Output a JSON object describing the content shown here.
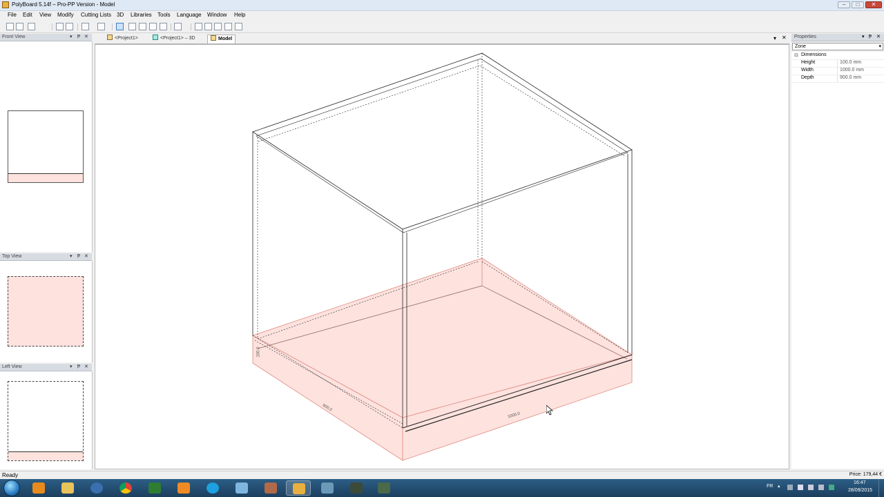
{
  "window": {
    "title": "PolyBoard 5.14f – Pro-PP Version - Model",
    "controls": {
      "minimize": "–",
      "maximize": "□",
      "close": "✕"
    }
  },
  "menu": [
    "File",
    "Edit",
    "View",
    "Modify",
    "Cutting Lists",
    "3D",
    "Libraries",
    "Tools",
    "Language",
    "Window",
    "Help"
  ],
  "toolbar": {
    "buttons": [
      "new-icon",
      "open-icon",
      "save-icon",
      "print-icon",
      "print-preview-icon",
      "undo-icon",
      "redo-icon",
      "select-icon",
      "cube-icon",
      "zoom-in-icon",
      "zoom-out-icon",
      "zoom-extents-icon",
      "pan-icon"
    ]
  },
  "left_panels": {
    "front": {
      "title": "Front View"
    },
    "top": {
      "title": "Top View"
    },
    "left": {
      "title": "Left View"
    },
    "panel_buttons": {
      "dropdown": "▾",
      "pin": "ᵽ",
      "close": "✕"
    }
  },
  "document": {
    "tabs": [
      {
        "label": "<Project1>",
        "icon": "project-icon",
        "active": false
      },
      {
        "label": "<Project1> – 3D",
        "icon": "cube-icon",
        "active": false
      },
      {
        "label": "Model",
        "icon": "model-icon",
        "active": true
      }
    ],
    "controls": {
      "dropdown": "▾",
      "close": "✕"
    }
  },
  "model": {
    "dim_height": "100.0",
    "dim_depth": "900.0",
    "dim_width": "1000.0",
    "colors": {
      "zone_fill": "#fde2de",
      "zone_edge": "#e08a80",
      "line": "#222222"
    }
  },
  "properties": {
    "title": "Properties",
    "selector": "Zone",
    "group": "Dimensions",
    "rows": [
      {
        "name": "Height",
        "value": "100.0 mm"
      },
      {
        "name": "Width",
        "value": "1000.0 mm"
      },
      {
        "name": "Depth",
        "value": "900.0 mm"
      }
    ]
  },
  "status": {
    "text": "Ready",
    "price": "Price: 179,44 €"
  },
  "taskbar": {
    "apps": [
      "start",
      "media-player",
      "file-explorer",
      "thunderbird",
      "chrome",
      "excel",
      "g-app",
      "skype",
      "polyboard-blue",
      "paint-tool",
      "polyboard",
      "vmware",
      "opticut",
      "recorder"
    ],
    "tray": {
      "lang": "FR",
      "time": "16:47",
      "date": "28/09/2015"
    }
  }
}
